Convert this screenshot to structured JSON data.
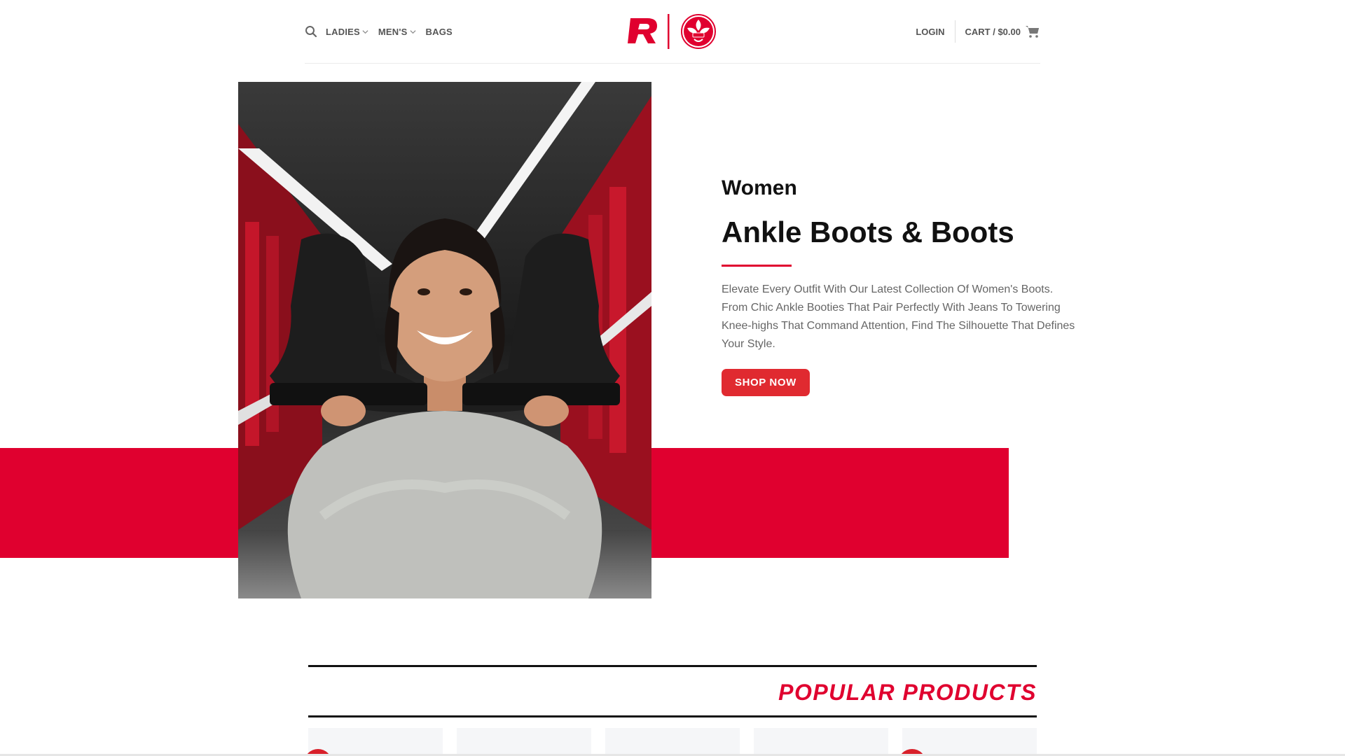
{
  "header": {
    "nav": [
      {
        "label": "LADIES",
        "dropdown": true
      },
      {
        "label": "MEN'S",
        "dropdown": true
      },
      {
        "label": "BAGS",
        "dropdown": false
      }
    ],
    "login_label": "LOGIN",
    "cart_label": "CART / $0.00"
  },
  "hero": {
    "kicker": "Women",
    "headline": "Ankle Boots & Boots",
    "description": "Elevate Every Outfit With Our Latest Collection Of Women's Boots. From Chic Ankle Booties That Pair Perfectly With Jeans To Towering Knee-highs That Command Attention, Find The Silhouette That Defines Your Style.",
    "cta_label": "SHOP NOW"
  },
  "popular": {
    "title": "POPULAR PRODUCTS"
  },
  "colors": {
    "brand_red": "#e0002f",
    "button_red": "#e02a30",
    "nav_gray": "#555555"
  },
  "icons": [
    "search-icon",
    "chevron-down-icon",
    "cart-icon",
    "rieker-r-logo",
    "rieker-flower-logo"
  ]
}
